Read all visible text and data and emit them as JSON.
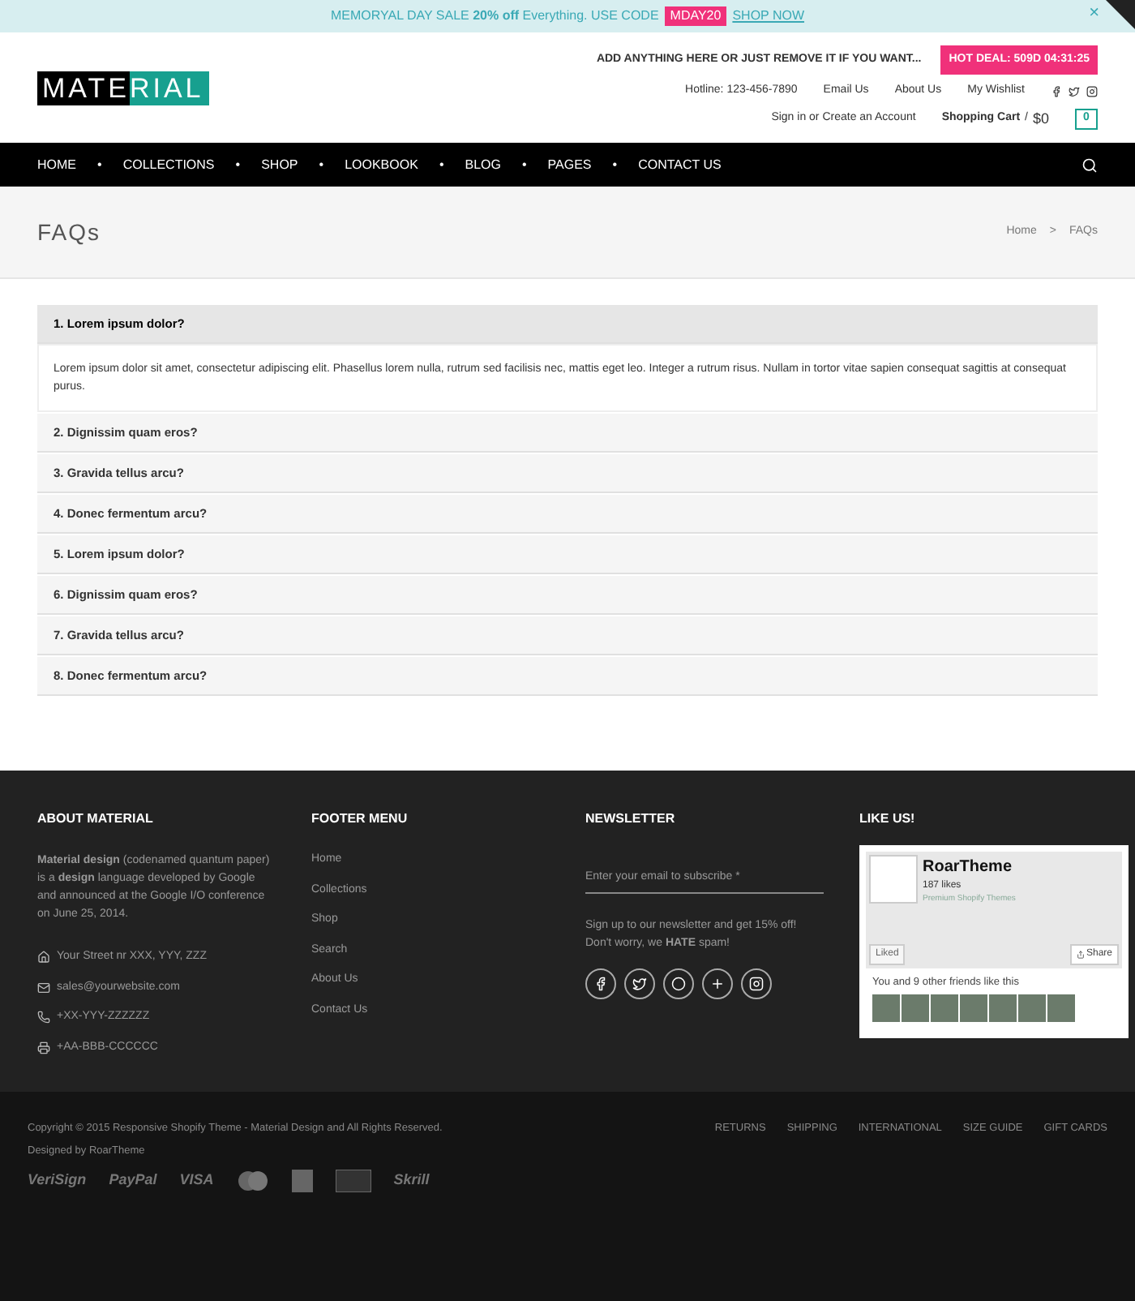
{
  "promo_bar": {
    "text": "MEMORYAL DAY SALE **20% off** Everything. USE CODE",
    "code": "MDAY20",
    "link": "SHOP NOW",
    "close": "×"
  },
  "header": {
    "logo_left": "MATE",
    "logo_right": "RIAL",
    "notice": "ADD ANYTHING HERE OR JUST REMOVE IT IF YOU WANT...",
    "hot_deal": "HOT DEAL: 509D 04:31:25",
    "links": [
      "Hotline: 123-456-7890",
      "Email Us",
      "About Us",
      "My Wishlist"
    ],
    "account": "Sign in or Create an Account",
    "cart_label": "Shopping Cart",
    "cart_sep": "/",
    "cart_total": "$0",
    "cart_count": "0"
  },
  "nav": {
    "items": [
      "HOME",
      "COLLECTIONS",
      "SHOP",
      "LOOKBOOK",
      "BLOG",
      "PAGES",
      "CONTACT US"
    ],
    "separator": "•"
  },
  "page_title": "FAQs",
  "breadcrumb": {
    "home": "Home",
    "separator": ">",
    "current": "FAQs"
  },
  "faqs": [
    {
      "question": "1. Lorem ipsum dolor?",
      "expanded": true,
      "answer": "Lorem ipsum dolor sit amet, consectetur adipiscing elit. Phasellus lorem nulla, rutrum sed facilisis nec, mattis eget leo. Integer a rutrum risus. Nullam in tortor vitae sapien consequat sagittis at consequat purus."
    },
    {
      "question": "2. Dignissim quam eros?",
      "expanded": false
    },
    {
      "question": "3. Gravida tellus arcu?",
      "expanded": false
    },
    {
      "question": "4. Donec fermentum arcu?",
      "expanded": false
    },
    {
      "question": "5. Lorem ipsum dolor?",
      "expanded": false
    },
    {
      "question": "6. Dignissim quam eros?",
      "expanded": false
    },
    {
      "question": "7. Gravida tellus arcu?",
      "expanded": false
    },
    {
      "question": "8. Donec fermentum arcu?",
      "expanded": false
    }
  ],
  "footer": {
    "about": {
      "title": "ABOUT MATERIAL",
      "text": "**Material design** (codenamed quantum paper) is a **design** language developed by Google and announced at the Google I/O conference on June 25, 2014.",
      "contacts": [
        {
          "kind": "address",
          "text": "Your Street nr XXX, YYY, ZZZ"
        },
        {
          "kind": "email",
          "text": "sales@yourwebsite.com"
        },
        {
          "kind": "phone",
          "text": "+XX-YYY-ZZZZZZ"
        },
        {
          "kind": "fax",
          "text": "+AA-BBB-CCCCCC"
        }
      ]
    },
    "menu": {
      "title": "FOOTER MENU",
      "items": [
        "Home",
        "Collections",
        "Shop",
        "Search",
        "About Us",
        "Contact Us"
      ]
    },
    "newsletter": {
      "title": "NEWSLETTER",
      "placeholder": "Enter your email to subscribe *",
      "text": "Sign up to our newsletter and get 15% off! Don't worry, we **HATE** spam!",
      "socials": [
        {
          "kind": "facebook"
        },
        {
          "kind": "twitter"
        },
        {
          "kind": "pinterest"
        },
        {
          "kind": "google-plus"
        },
        {
          "kind": "instagram"
        }
      ]
    },
    "like": {
      "title": "LIKE US!",
      "page_name": "RoarTheme",
      "likes": "187 likes",
      "tagline": "Premium Shopify Themes",
      "liked": "Liked",
      "share": "Share",
      "friends_text": "You and 9 other friends like this"
    }
  },
  "bottom": {
    "copyright": "Copyright © 2015 Responsive Shopify Theme - Material Design and All Rights Reserved.",
    "designed_by": "Designed by RoarTheme",
    "links": [
      "RETURNS",
      "SHIPPING",
      "INTERNATIONAL",
      "SIZE GUIDE",
      "GIFT CARDS"
    ],
    "payments": [
      {
        "kind": "text",
        "label": "VeriSign"
      },
      {
        "kind": "text",
        "label": "PayPal"
      },
      {
        "kind": "text",
        "label": "VISA"
      },
      {
        "kind": "circles"
      },
      {
        "kind": "square"
      },
      {
        "kind": "card"
      },
      {
        "kind": "text",
        "label": "Skrill"
      }
    ]
  }
}
